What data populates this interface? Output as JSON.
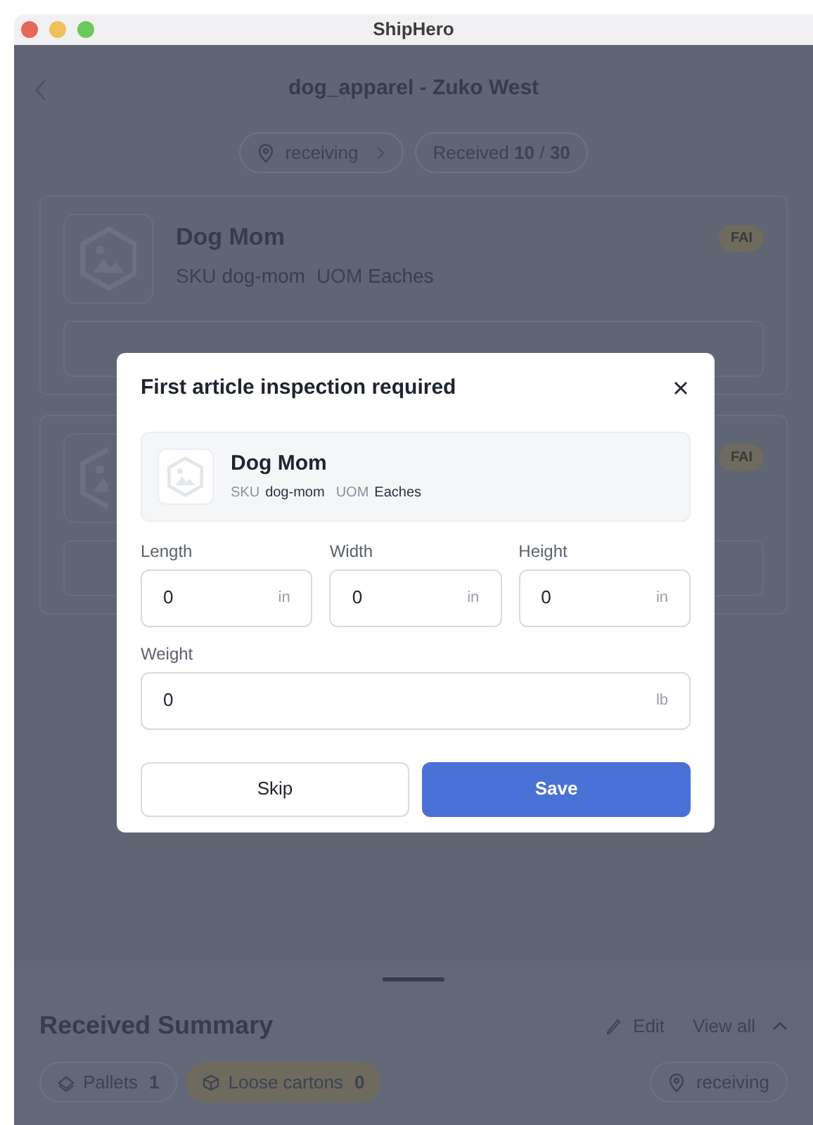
{
  "window": {
    "title": "ShipHero"
  },
  "header": {
    "title": "dog_apparel - Zuko West"
  },
  "chips": [
    {
      "kind": "location",
      "label": "receiving"
    },
    {
      "kind": "count",
      "label": "Received **10** / **30**"
    }
  ],
  "items": [
    {
      "name": "Dog Mom",
      "sku_label": "SKU",
      "sku": "dog-mom",
      "uom_label": "UOM",
      "uom": "Eaches",
      "badge": "FAI"
    },
    {
      "badge": "FAI"
    }
  ],
  "modal": {
    "title": "First article inspection required",
    "product": {
      "name": "Dog Mom",
      "sku_label": "SKU",
      "sku": "dog-mom",
      "uom_label": "UOM",
      "uom": "Eaches"
    },
    "fields": [
      {
        "label": "Length",
        "value": "0",
        "unit": "in",
        "wide": false
      },
      {
        "label": "Width",
        "value": "0",
        "unit": "in",
        "wide": false
      },
      {
        "label": "Height",
        "value": "0",
        "unit": "in",
        "wide": false
      },
      {
        "label": "Weight",
        "value": "0",
        "unit": "lb",
        "wide": true
      }
    ],
    "buttons": [
      {
        "label": "Skip",
        "kind": "secondary"
      },
      {
        "label": "Save",
        "kind": "primary"
      }
    ]
  },
  "summary": {
    "title": "Received Summary",
    "actions": [
      {
        "kind": "edit",
        "label": "Edit"
      },
      {
        "kind": "view",
        "label": "View all"
      }
    ],
    "chips": [
      {
        "kind": "pallets",
        "label": "Pallets",
        "count": "1",
        "selected": false
      },
      {
        "kind": "cartons",
        "label": "Loose cartons",
        "count": "0",
        "selected": true
      }
    ],
    "location": "receiving"
  }
}
